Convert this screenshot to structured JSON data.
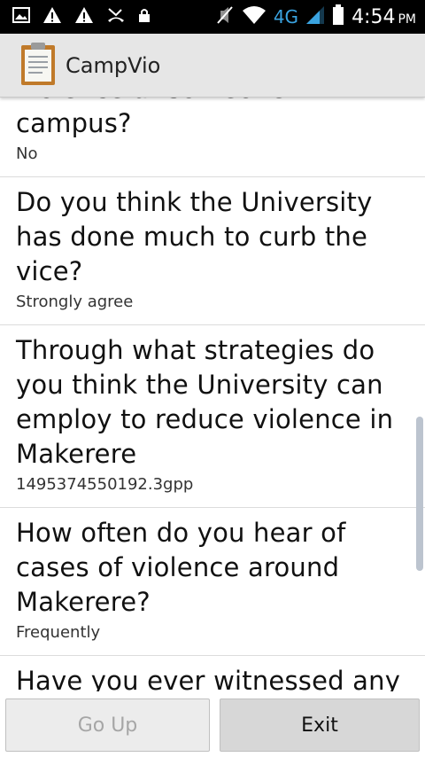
{
  "status_bar": {
    "time": "4:54",
    "ampm": "PM",
    "network": "4G",
    "icons": [
      "image-icon",
      "warning-icon",
      "warning-icon",
      "missed-call-icon",
      "lock-icon",
      "mute-icon",
      "wifi-icon",
      "signal-icon",
      "battery-icon"
    ]
  },
  "action_bar": {
    "title": "CampVio",
    "icon": "clipboard-icon"
  },
  "items": [
    {
      "question": "violence at someone in campus?",
      "answer": "No"
    },
    {
      "question": "Do you think the University has done much to curb the vice?",
      "answer": "Strongly agree"
    },
    {
      "question": "Through what strategies do you think the University can employ to reduce violence in Makerere",
      "answer": "1495374550192.3gpp"
    },
    {
      "question": "How often do you hear of cases of violence around Makerere?",
      "answer": "Frequently"
    },
    {
      "question": "Have you ever witnessed any",
      "answer": ""
    }
  ],
  "buttons": {
    "go_up": "Go Up",
    "exit": "Exit"
  }
}
